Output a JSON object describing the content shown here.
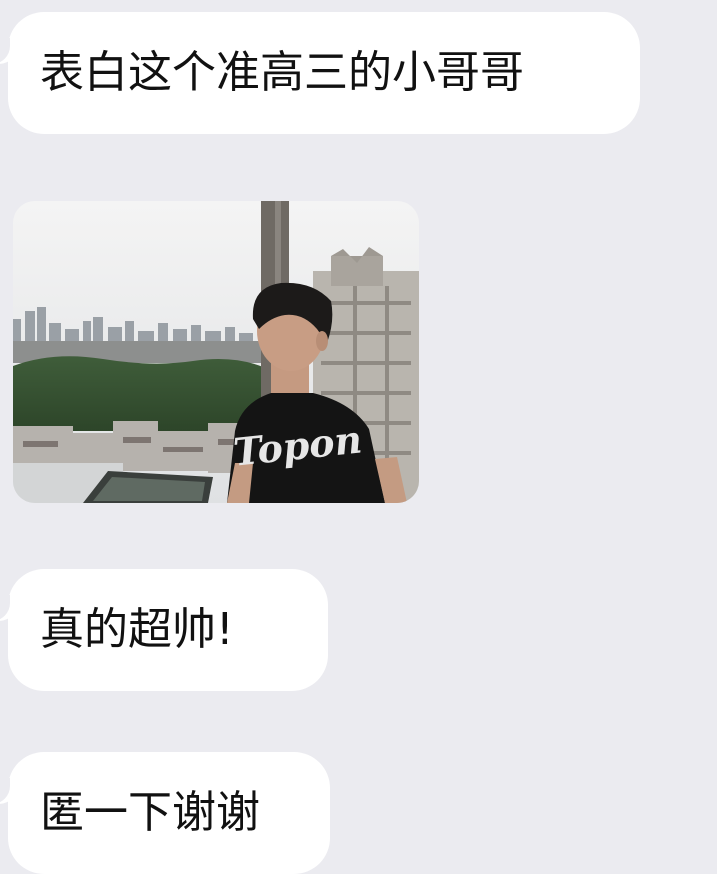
{
  "messages": [
    {
      "text": "表白这个准高三的小哥哥"
    },
    {
      "text": "真的超帅!"
    },
    {
      "text": "匿一下谢谢"
    }
  ],
  "photo": {
    "shirt_text": "Topon"
  },
  "colors": {
    "background": "#ebebf0",
    "bubble": "#ffffff",
    "text": "#111111"
  }
}
